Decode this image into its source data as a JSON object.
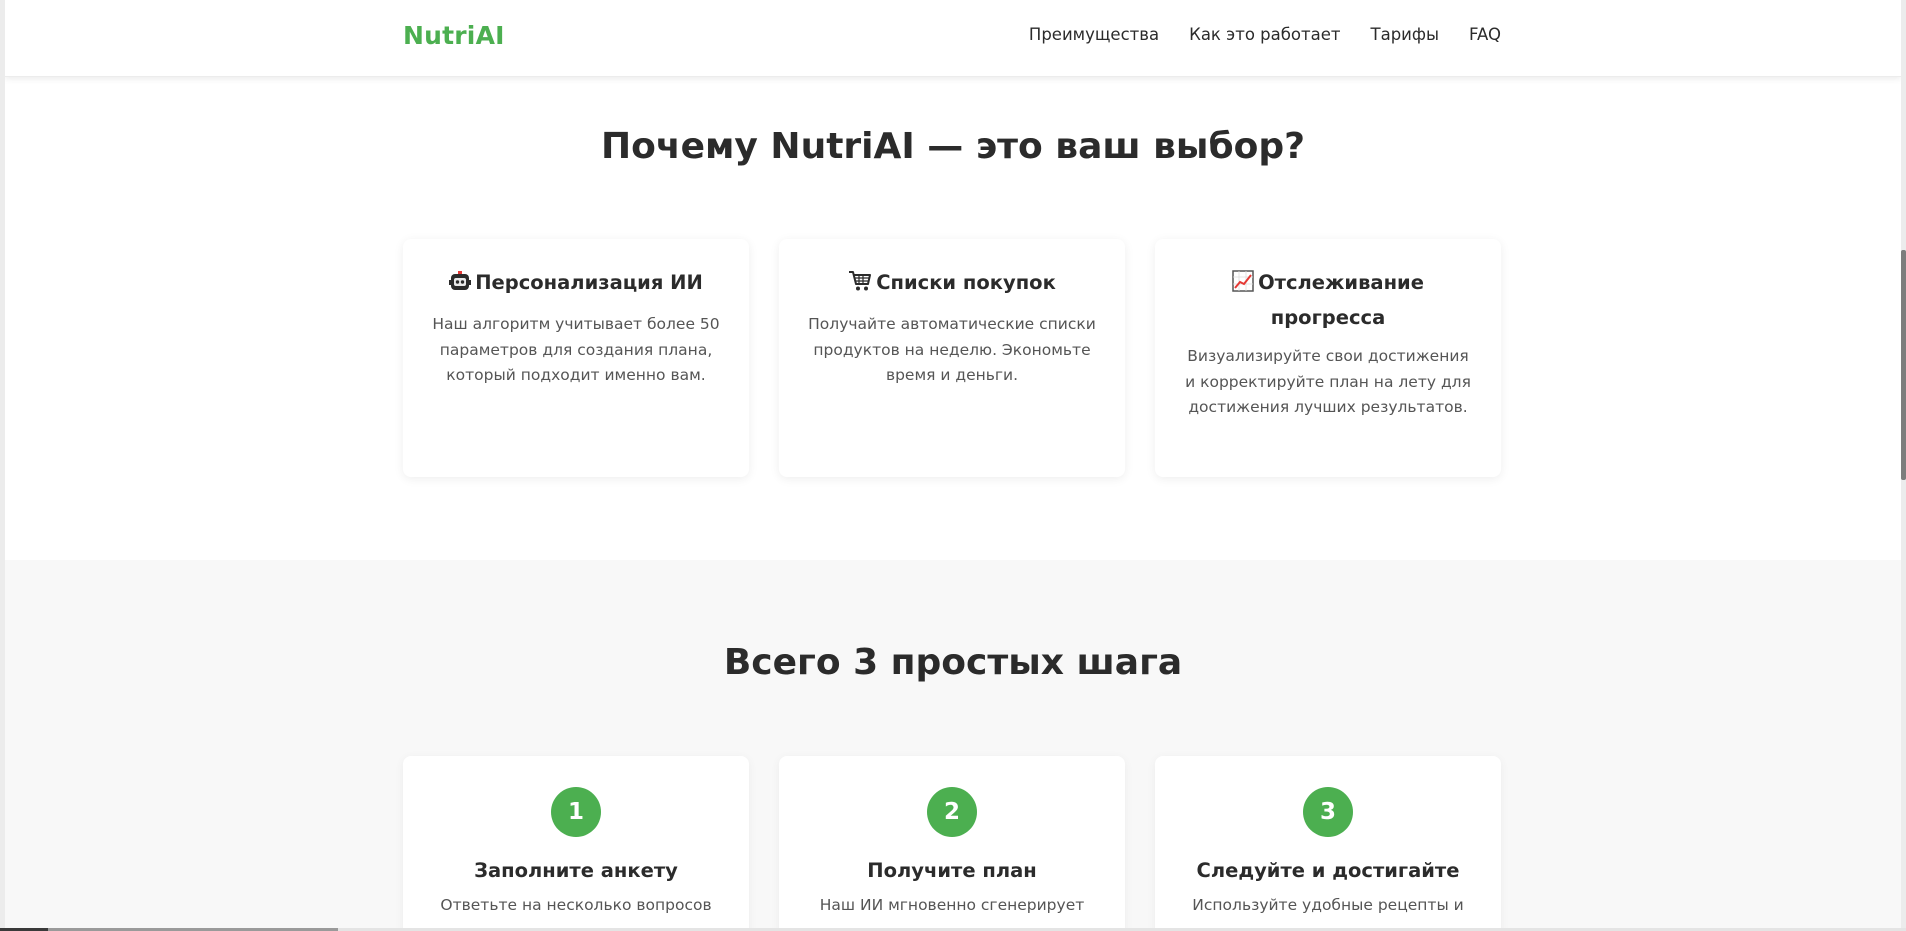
{
  "header": {
    "logo": "NutriAI",
    "nav": [
      "Преимущества",
      "Как это работает",
      "Тарифы",
      "FAQ"
    ]
  },
  "features": {
    "title": "Почему NutriAI — это ваш выбор?",
    "cards": [
      {
        "icon": "robot-icon",
        "title": "Персонализация ИИ",
        "text": "Наш алгоритм учитывает более 50 параметров для создания плана, который подходит именно вам."
      },
      {
        "icon": "shopping-cart-icon",
        "title": "Списки покупок",
        "text": "Получайте автоматические списки продуктов на неделю. Экономьте время и деньги."
      },
      {
        "icon": "chart-increasing-icon",
        "title": "Отслеживание прогресса",
        "text": "Визуализируйте свои достижения и корректируйте план на лету для достижения лучших результатов."
      }
    ]
  },
  "steps": {
    "title": "Всего 3 простых шага",
    "items": [
      {
        "number": "1",
        "title": "Заполните анкету",
        "text": "Ответьте на несколько вопросов"
      },
      {
        "number": "2",
        "title": "Получите план",
        "text": "Наш ИИ мгновенно сгенерирует"
      },
      {
        "number": "3",
        "title": "Следуйте и достигайте",
        "text": "Используйте удобные рецепты и"
      }
    ]
  },
  "colors": {
    "accent": "#4caf50",
    "text": "#2b2b2b",
    "muted": "#555555",
    "section_alt_bg": "#f8f8f8"
  }
}
